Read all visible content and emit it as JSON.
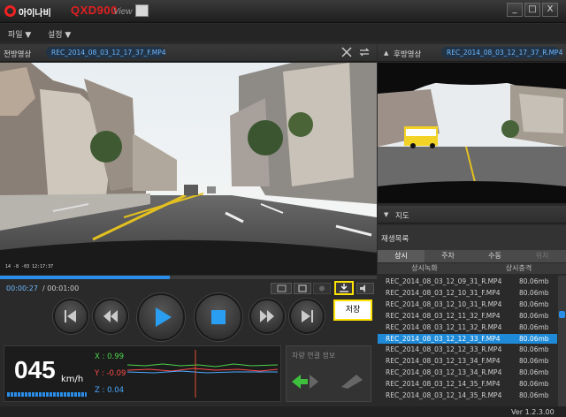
{
  "app": {
    "logo_text": "아이나비",
    "model": "QXD900",
    "model_suffix": "View"
  },
  "window": {
    "minimize": "_",
    "maximize": "□",
    "close": "X"
  },
  "menu": {
    "file": "파일 ▼",
    "settings": "설정 ▼"
  },
  "front": {
    "label": "전방영상",
    "filename": "REC_2014_08_03_12_17_37_F.MP4"
  },
  "rear": {
    "label": "후방영상",
    "filename": "REC_2014_08_03_12_17_37_R.MP4"
  },
  "map": {
    "label": "지도"
  },
  "playlist": {
    "label": "재생목록",
    "tabs": [
      "상시",
      "주차",
      "수동",
      "위치"
    ],
    "subtabs": [
      "상시녹화",
      "상시충격"
    ],
    "files": [
      {
        "name": "REC_2014_08_03_12_09_31_R.MP4",
        "size": "80.06mb"
      },
      {
        "name": "REC_2014_08_03_12_10_31_F.MP4",
        "size": "80.06mb"
      },
      {
        "name": "REC_2014_08_03_12_10_31_R.MP4",
        "size": "80.06mb"
      },
      {
        "name": "REC_2014_08_03_12_11_32_F.MP4",
        "size": "80.06mb"
      },
      {
        "name": "REC_2014_08_03_12_11_32_R.MP4",
        "size": "80.06mb"
      },
      {
        "name": "REC_2014_08_03_12_12_33_F.MP4",
        "size": "80.06mb"
      },
      {
        "name": "REC_2014_08_03_12_12_33_R.MP4",
        "size": "80.06mb"
      },
      {
        "name": "REC_2014_08_03_12_13_34_F.MP4",
        "size": "80.06mb"
      },
      {
        "name": "REC_2014_08_03_12_13_34_R.MP4",
        "size": "80.06mb"
      },
      {
        "name": "REC_2014_08_03_12_14_35_F.MP4",
        "size": "80.06mb"
      },
      {
        "name": "REC_2014_08_03_12_14_35_R.MP4",
        "size": "80.06mb"
      }
    ],
    "selected_index": 5
  },
  "playback": {
    "current": "00:00:27",
    "total": "/ 00:01:00",
    "progress": 0.45
  },
  "tooltip": "저장",
  "speed": {
    "value": "045",
    "unit": "km/h"
  },
  "gsensor": {
    "x": "X : 0.99",
    "y": "Y : -0.09",
    "z": "Z : 0.04"
  },
  "car_info": {
    "label": "차량 연결 정보"
  },
  "version": "Ver 1.2.3.00",
  "colors": {
    "accent": "#2a8ee8",
    "highlight": "#ffe200",
    "brand_red": "#e02020"
  }
}
